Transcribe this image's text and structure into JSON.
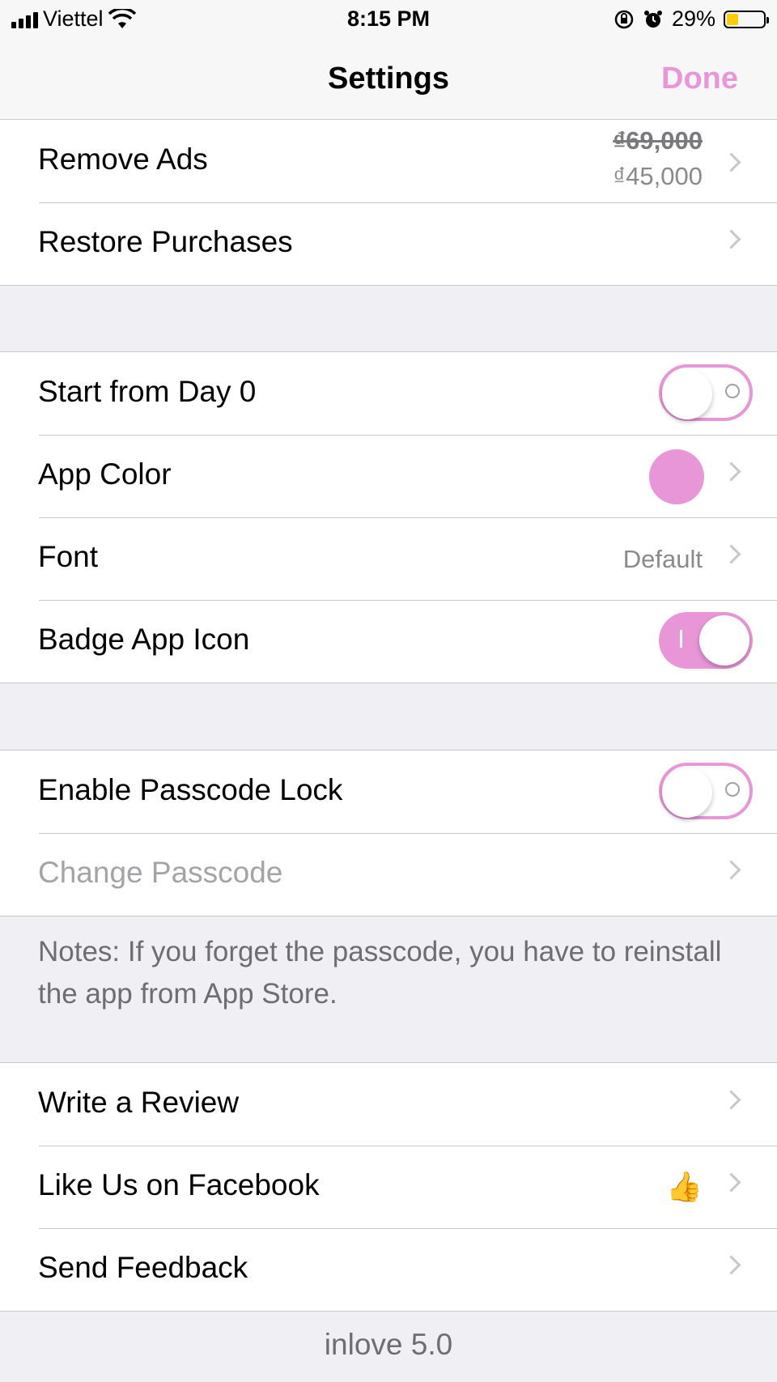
{
  "status": {
    "carrier": "Viettel",
    "time": "8:15 PM",
    "battery": "29%",
    "battery_level": 0.29,
    "icons": [
      "signal-icon",
      "wifi-icon",
      "orientation-lock-icon",
      "alarm-icon",
      "battery-icon"
    ]
  },
  "nav": {
    "title": "Settings",
    "done": "Done"
  },
  "colors": {
    "accent": "#e896d8",
    "separator": "#c8c7cc",
    "background": "#efeff4"
  },
  "purchase": {
    "remove_ads": "Remove Ads",
    "price_old": "₫69,000",
    "price_new": "₫45,000",
    "restore": "Restore Purchases"
  },
  "prefs": {
    "start_day0": "Start from Day 0",
    "start_day0_on": false,
    "app_color": "App Color",
    "font": "Font",
    "font_value": "Default",
    "badge": "Badge App Icon",
    "badge_on": true
  },
  "security": {
    "passcode": "Enable Passcode Lock",
    "passcode_on": false,
    "change": "Change Passcode",
    "note": "Notes: If you forget the passcode, you have to reinstall the app from App Store."
  },
  "social": {
    "review": "Write a Review",
    "facebook": "Like Us on Facebook",
    "feedback": "Send Feedback"
  },
  "footer": "inlove 5.0"
}
